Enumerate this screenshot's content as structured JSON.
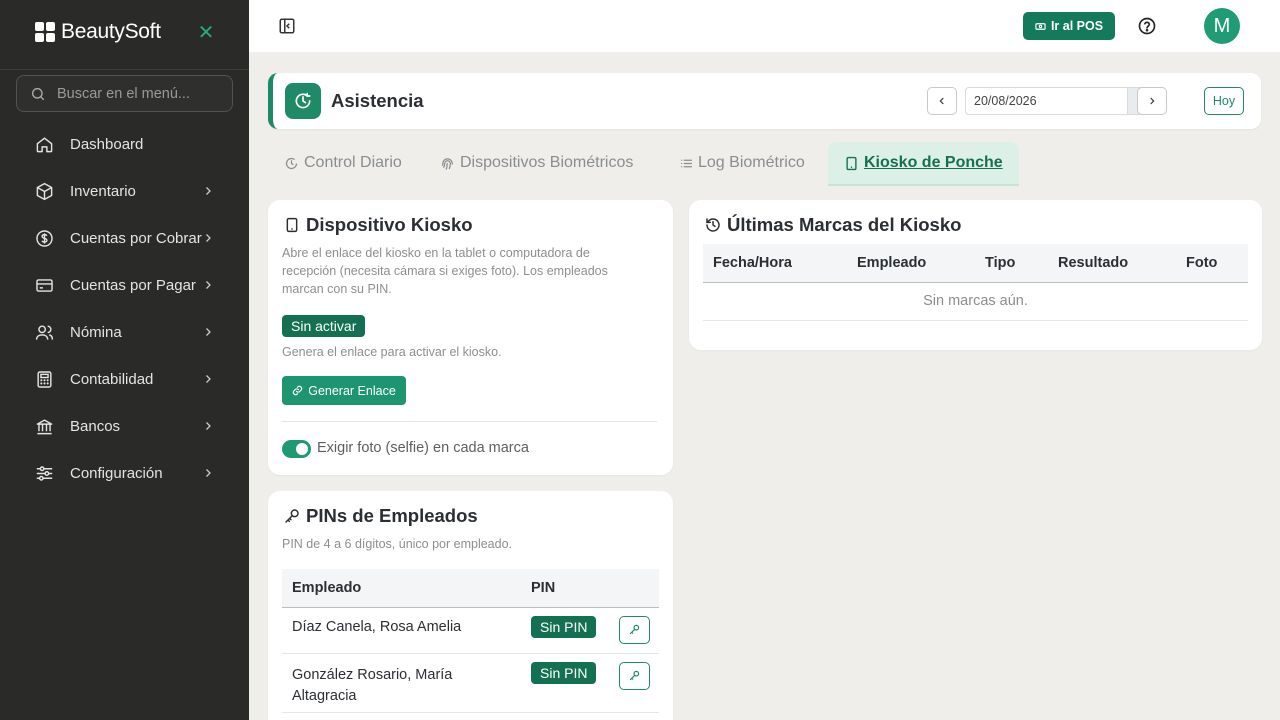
{
  "sidebar": {
    "brand": "BeautySoft",
    "search_placeholder": "Buscar en el menú...",
    "items": [
      {
        "label": "Dashboard",
        "icon": "home-icon",
        "has_children": false
      },
      {
        "label": "Inventario",
        "icon": "box-icon",
        "has_children": true
      },
      {
        "label": "Cuentas por Cobrar",
        "icon": "dollar-icon",
        "has_children": true
      },
      {
        "label": "Cuentas por Pagar",
        "icon": "card-icon",
        "has_children": true
      },
      {
        "label": "Nómina",
        "icon": "users-icon",
        "has_children": true
      },
      {
        "label": "Contabilidad",
        "icon": "calculator-icon",
        "has_children": true
      },
      {
        "label": "Bancos",
        "icon": "bank-icon",
        "has_children": true
      },
      {
        "label": "Configuración",
        "icon": "sliders-icon",
        "has_children": true
      }
    ]
  },
  "topbar": {
    "pos_label": "Ir al POS",
    "avatar_initial": "M"
  },
  "header": {
    "title": "Asistencia",
    "date_value": "20/08/2026",
    "today_label": "Hoy"
  },
  "tabs": [
    {
      "label": "Control Diario",
      "icon": "clock-icon",
      "active": false
    },
    {
      "label": "Dispositivos Biométricos",
      "icon": "fingerprint-icon",
      "active": false
    },
    {
      "label": "Log Biométrico",
      "icon": "list-icon",
      "active": false
    },
    {
      "label": "Kiosko de Ponche",
      "icon": "tablet-icon",
      "active": true
    }
  ],
  "kiosk": {
    "title": "Dispositivo Kiosko",
    "description": "Abre el enlace del kiosko en la tablet o computadora de recepción (necesita cámara si exiges foto). Los empleados marcan con su PIN.",
    "status_badge": "Sin activar",
    "status_hint": "Genera el enlace para activar el kiosko.",
    "generate_label": "Generar Enlace",
    "selfie_label": "Exigir foto (selfie) en cada marca",
    "selfie_required": true
  },
  "pins": {
    "title": "PINs de Empleados",
    "subtitle": "PIN de 4 a 6 dígitos, único por empleado.",
    "columns": [
      "Empleado",
      "PIN"
    ],
    "rows": [
      {
        "employee": "Díaz Canela, Rosa Amelia",
        "pin": "Sin PIN"
      },
      {
        "employee": "González Rosario, María Altagracia",
        "pin": "Sin PIN"
      }
    ]
  },
  "marks": {
    "title": "Últimas Marcas del Kiosko",
    "columns": [
      "Fecha/Hora",
      "Empleado",
      "Tipo",
      "Resultado",
      "Foto"
    ],
    "empty_text": "Sin marcas aún."
  },
  "colors": {
    "primary": "#1c8a67",
    "sidebar_bg": "#2a2a28",
    "page_bg": "#f0eeea"
  }
}
